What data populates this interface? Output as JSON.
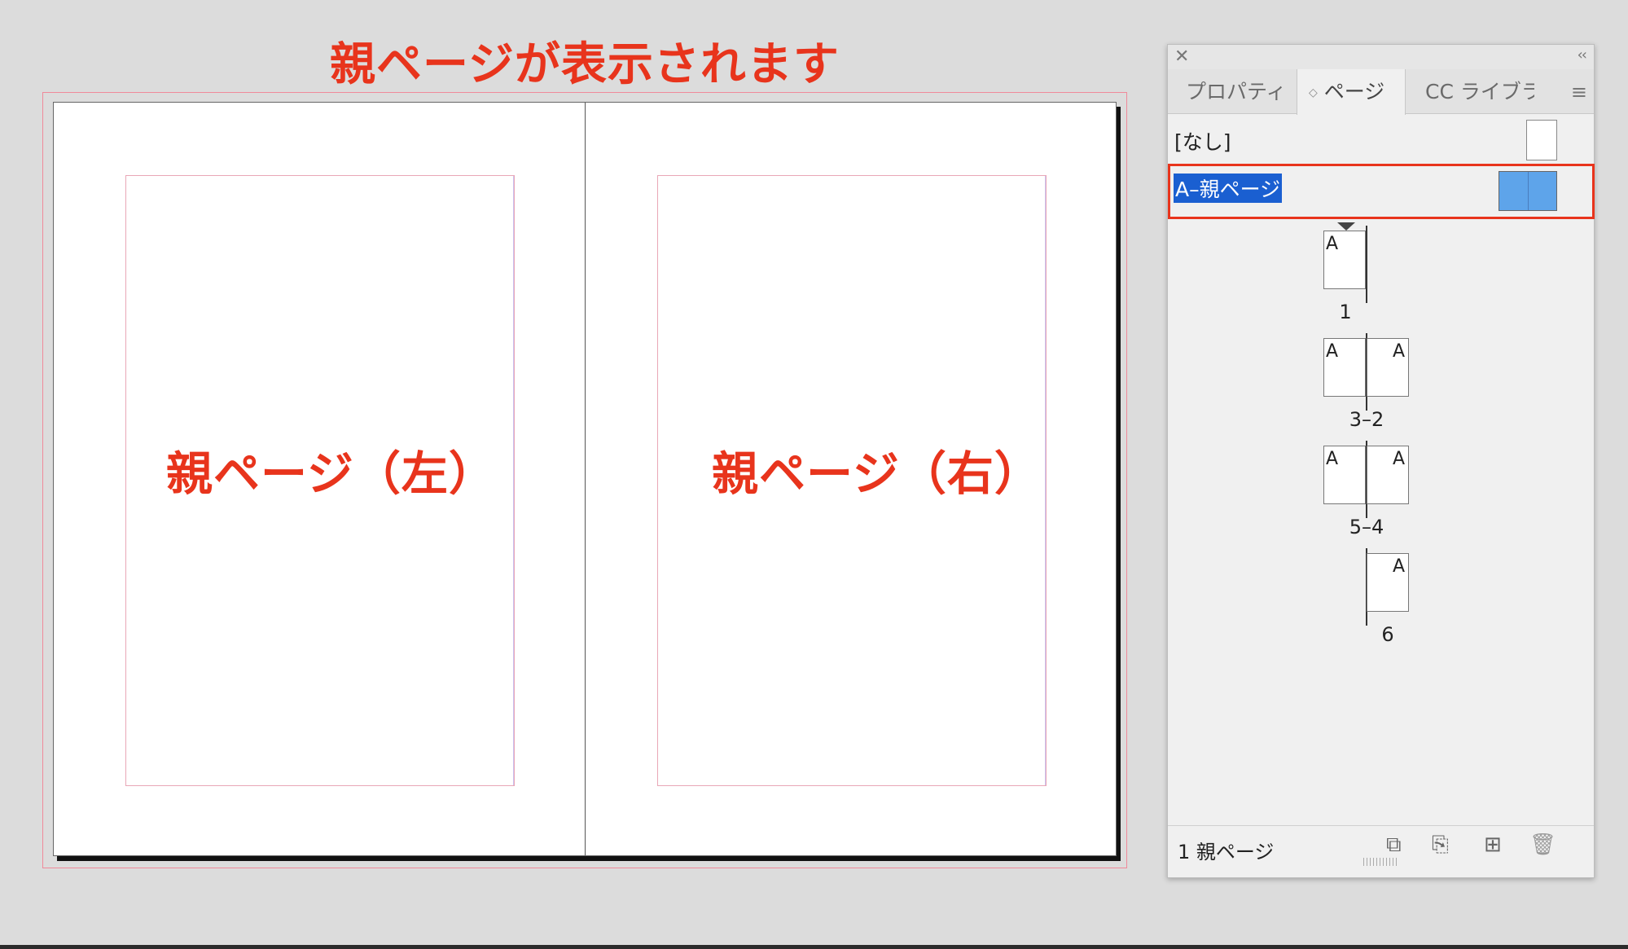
{
  "canvas": {
    "caption": "親ページが表示されます",
    "left_page_caption": "親ページ（左）",
    "right_page_caption": "親ページ（右）"
  },
  "panel": {
    "tabs": {
      "properties": "プロパティ",
      "pages": "ページ",
      "cc_libraries": "CC ライブラ"
    },
    "parents": {
      "none_label": "[なし]",
      "a_label": "A–親ページ"
    },
    "pages": [
      {
        "number": "1",
        "left": null,
        "right": "A"
      },
      {
        "number": "3–2",
        "left": "A",
        "right": "A"
      },
      {
        "number": "5–4",
        "left": "A",
        "right": "A"
      },
      {
        "number": "6",
        "left": "A",
        "right": null
      }
    ],
    "footer": {
      "status": "1 親ページ"
    }
  },
  "colors": {
    "annotation_red": "#e8341c",
    "selection_blue": "#1a5fd1",
    "parent_thumb_blue": "#5ea4ea"
  }
}
